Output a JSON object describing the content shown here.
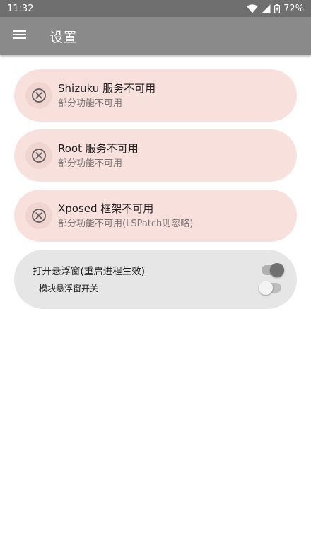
{
  "status_bar": {
    "time": "11:32",
    "battery_percent": "72%",
    "icons": [
      "wifi-icon",
      "cell-signal-icon",
      "battery-icon"
    ]
  },
  "app_bar": {
    "title": "设置",
    "menu_icon": "menu-icon"
  },
  "status_cards": [
    {
      "title": "Shizuku 服务不可用",
      "subtitle": "部分功能不可用",
      "icon": "error-circle-x-icon"
    },
    {
      "title": "Root 服务不可用",
      "subtitle": "部分功能不可用",
      "icon": "error-circle-x-icon"
    },
    {
      "title": "Xposed 框架不可用",
      "subtitle": "部分功能不可用(LSPatch则忽略)",
      "icon": "error-circle-x-icon"
    }
  ],
  "settings": {
    "floating_window": {
      "label": "打开悬浮窗(重启进程生效)",
      "checked": true
    },
    "module_floating_switch": {
      "label": "模块悬浮窗开关",
      "checked": false
    }
  },
  "colors": {
    "status_bar": "#6f6f6f",
    "app_bar": "#8a8a8a",
    "error_card": "#f8e1dd",
    "settings_card": "#e6e6e6"
  }
}
